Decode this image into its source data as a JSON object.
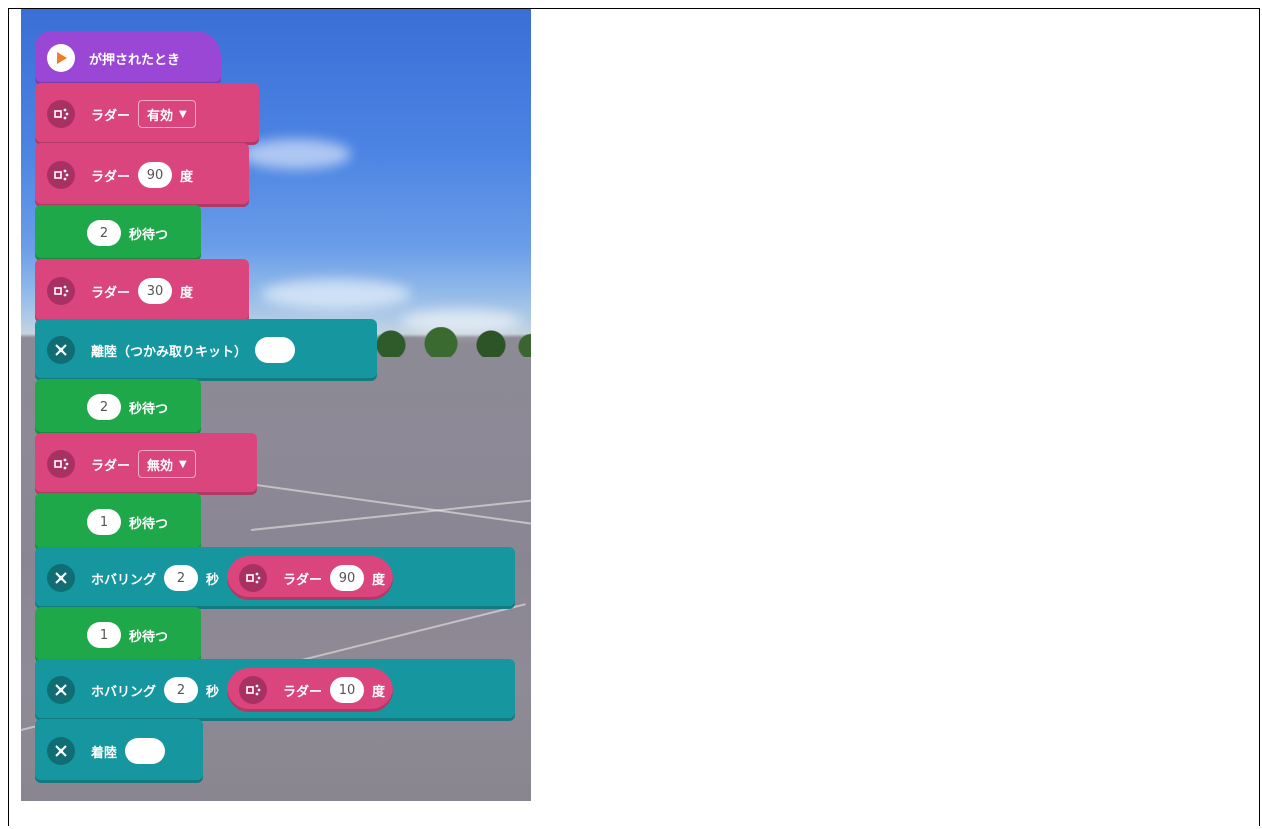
{
  "blocks": {
    "start": {
      "label": "が押されたとき"
    },
    "rudder_enable": {
      "label": "ラダー",
      "dropdown": "有効"
    },
    "rudder_90": {
      "label": "ラダー",
      "value": "90",
      "unit": "度"
    },
    "wait_1": {
      "value": "2",
      "label": "秒待つ"
    },
    "rudder_30": {
      "label": "ラダー",
      "value": "30",
      "unit": "度"
    },
    "takeoff": {
      "label": "離陸（つかみ取りキット）"
    },
    "wait_2": {
      "value": "2",
      "label": "秒待つ"
    },
    "rudder_disable": {
      "label": "ラダー",
      "dropdown": "無効"
    },
    "wait_3": {
      "value": "1",
      "label": "秒待つ"
    },
    "hover_1": {
      "label": "ホバリング",
      "value": "2",
      "unit": "秒",
      "rudder_label": "ラダー",
      "rudder_value": "90",
      "rudder_unit": "度"
    },
    "wait_4": {
      "value": "1",
      "label": "秒待つ"
    },
    "hover_2": {
      "label": "ホバリング",
      "value": "2",
      "unit": "秒",
      "rudder_label": "ラダー",
      "rudder_value": "10",
      "rudder_unit": "度"
    },
    "land": {
      "label": "着陸"
    }
  },
  "icons": {
    "start": "play-icon",
    "rudder": "rudder-icon",
    "drone": "drone-icon"
  },
  "colors": {
    "event": "#9b47d6",
    "rudder": "#d9457c",
    "control": "#1fa84a",
    "flight": "#16979f"
  }
}
